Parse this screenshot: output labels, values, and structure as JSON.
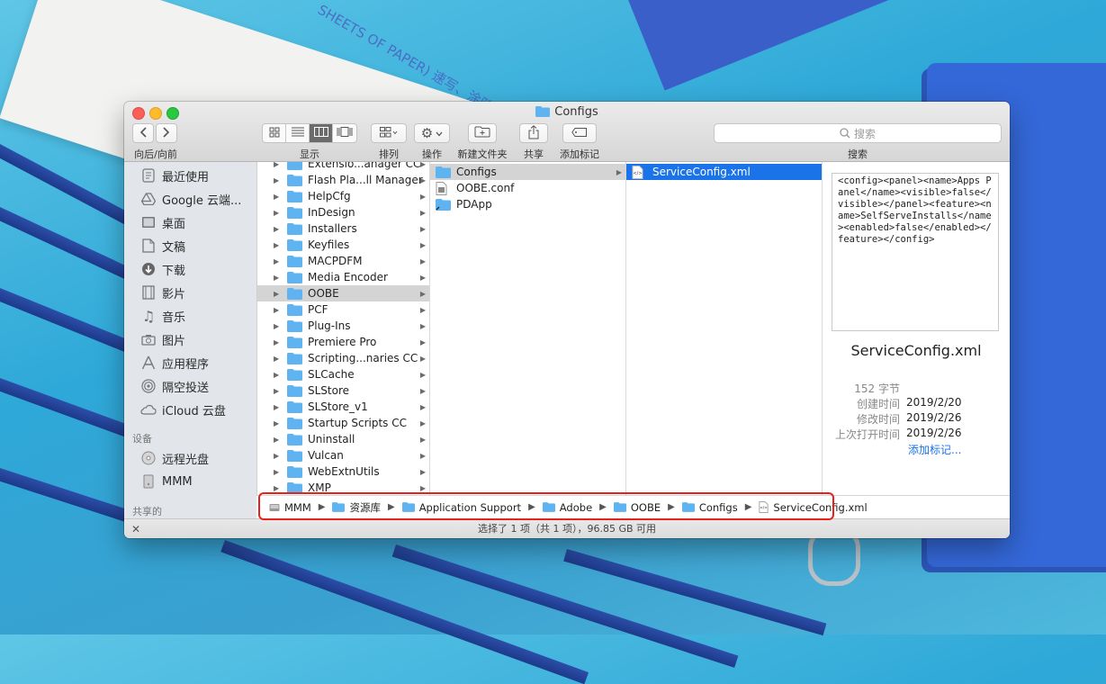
{
  "window": {
    "title": "Configs"
  },
  "toolbar": {
    "nav_label": "向后/向前",
    "view_label": "显示",
    "sort_label": "排列",
    "action_label": "操作",
    "new_folder_label": "新建文件夹",
    "share_label": "共享",
    "tag_label": "添加标记",
    "search_placeholder": "搜索",
    "search_label": "搜索"
  },
  "sidebar": {
    "favorites": [
      {
        "label": "最近使用",
        "icon": "recents-icon"
      },
      {
        "label": "Google 云端...",
        "icon": "google-drive-icon"
      },
      {
        "label": "桌面",
        "icon": "desktop-icon"
      },
      {
        "label": "文稿",
        "icon": "documents-icon"
      },
      {
        "label": "下载",
        "icon": "downloads-icon"
      },
      {
        "label": "影片",
        "icon": "movies-icon"
      },
      {
        "label": "音乐",
        "icon": "music-icon"
      },
      {
        "label": "图片",
        "icon": "pictures-icon"
      },
      {
        "label": "应用程序",
        "icon": "applications-icon"
      },
      {
        "label": "隔空投送",
        "icon": "airdrop-icon"
      },
      {
        "label": "iCloud 云盘",
        "icon": "icloud-icon"
      }
    ],
    "devices_header": "设备",
    "devices": [
      {
        "label": "远程光盘",
        "icon": "remote-disc-icon"
      },
      {
        "label": "MMM",
        "icon": "hard-drive-icon"
      }
    ],
    "shared_header": "共享的"
  },
  "column1": {
    "items": [
      "Extensio...anager CC",
      "Flash Pla...ll Manager",
      "HelpCfg",
      "InDesign",
      "Installers",
      "Keyfiles",
      "MACPDFM",
      "Media Encoder",
      "OOBE",
      "PCF",
      "Plug-Ins",
      "Premiere Pro",
      "Scripting...naries CC",
      "SLCache",
      "SLStore",
      "SLStore_v1",
      "Startup Scripts CC",
      "Uninstall",
      "Vulcan",
      "WebExtnUtils",
      "XMP"
    ],
    "selected": "OOBE"
  },
  "column2": {
    "items": [
      {
        "label": "Configs",
        "type": "folder"
      },
      {
        "label": "OOBE.conf",
        "type": "file"
      },
      {
        "label": "PDApp",
        "type": "alias"
      }
    ],
    "selected": "Configs"
  },
  "column3": {
    "items": [
      {
        "label": "ServiceConfig.xml",
        "type": "xml"
      }
    ],
    "selected": "ServiceConfig.xml"
  },
  "preview": {
    "content": "<config><panel><name>Apps Panel</name><visible>false</visible></panel><feature><name>SelfServeInstalls</name><enabled>false</enabled></feature></config>",
    "filename": "ServiceConfig.xml",
    "size": "152 字节",
    "created_label": "创建时间",
    "created": "2019/2/20",
    "modified_label": "修改时间",
    "modified": "2019/2/26",
    "opened_label": "上次打开时间",
    "opened": "2019/2/26",
    "add_tag": "添加标记..."
  },
  "pathbar": [
    {
      "label": "MMM",
      "icon": "hard-drive-icon"
    },
    {
      "label": "资源库",
      "icon": "folder-icon"
    },
    {
      "label": "Application Support",
      "icon": "folder-icon"
    },
    {
      "label": "Adobe",
      "icon": "folder-icon"
    },
    {
      "label": "OOBE",
      "icon": "folder-icon"
    },
    {
      "label": "Configs",
      "icon": "folder-icon"
    },
    {
      "label": "ServiceConfig.xml",
      "icon": "xml-file-icon"
    }
  ],
  "status": {
    "text": "选择了 1 项（共 1 项），96.85 GB 可用"
  },
  "background": {
    "notebook_text": "SHEETS OF PAPER)  速写、涂鸦"
  },
  "colors": {
    "selection_blue": "#1a73e8",
    "highlight_red": "#e8211b",
    "folder_blue": "#5fb3f0"
  }
}
